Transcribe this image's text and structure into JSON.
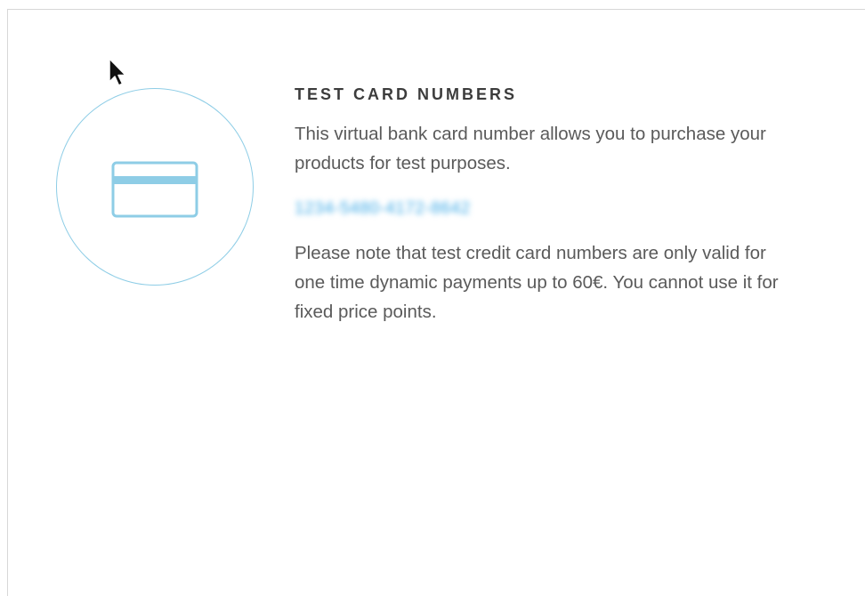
{
  "info_panel": {
    "icon": "credit-card-icon",
    "accent_color": "#8ecde6",
    "title": "TEST CARD NUMBERS",
    "intro": "This virtual bank card number allows you to purchase your products for test purposes.",
    "card_number": "1234-5480-4172-8642",
    "note": "Please note that test credit card numbers are only valid for one time dynamic payments up to 60€. You cannot use it for fixed price points."
  }
}
